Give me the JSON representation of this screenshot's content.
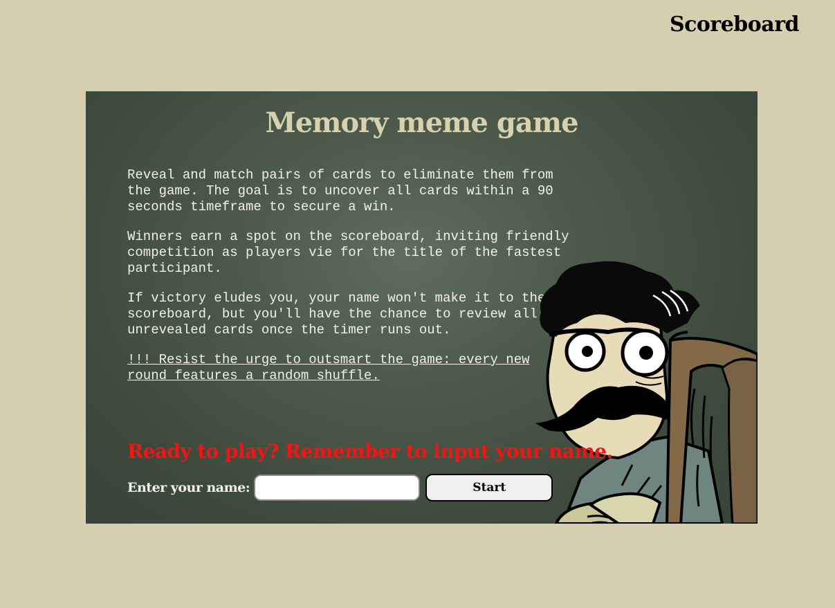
{
  "header": {
    "scoreboard_link": "Scoreboard"
  },
  "board": {
    "title": "Memory meme game",
    "rules": [
      "Reveal and match pairs of cards to eliminate them from the game. The goal is to uncover all cards within a 90 seconds timeframe to secure a win.",
      "Winners earn a spot on the scoreboard, inviting friendly competition as players vie for the title of the fastest participant.",
      "If victory eludes you, your name won't make it to the scoreboard, but you'll have the chance to review all the unrevealed cards once the timer runs out."
    ],
    "warning": "!!! Resist the urge to outsmart the game: every new round features a random shuffle.",
    "ready_prompt": "Ready to play? Remember to input your name.",
    "name_label": "Enter your name:",
    "name_value": "",
    "start_button": "Start",
    "illustration": "meme-character-peeking-icon"
  },
  "colors": {
    "page_background": "#d5cfb0",
    "board_background": "#4c5a4b",
    "title": "#d8d1ad",
    "prompt": "#f41414",
    "text": "#f3f1ea"
  }
}
